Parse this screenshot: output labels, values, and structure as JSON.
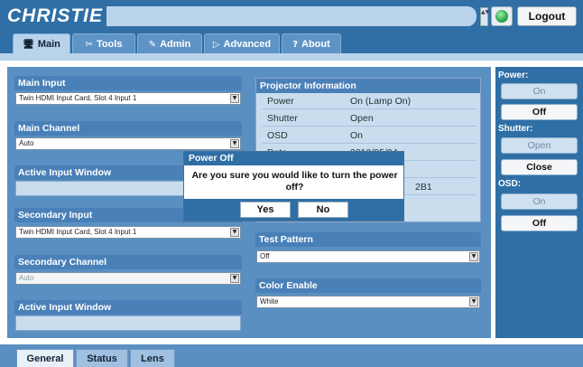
{
  "header": {
    "logo_text": "CHRISTIE",
    "logout_label": "Logout",
    "scroll_arrows": "▲▼"
  },
  "tabs": [
    {
      "label": "Main",
      "icon": "monitor-icon",
      "glyph": "🖥"
    },
    {
      "label": "Tools",
      "icon": "tools-icon",
      "glyph": "✂"
    },
    {
      "label": "Admin",
      "icon": "admin-icon",
      "glyph": "✎"
    },
    {
      "label": "Advanced",
      "icon": "advanced-icon",
      "glyph": "▷"
    },
    {
      "label": "About",
      "icon": "question-icon",
      "glyph": "?"
    }
  ],
  "left": {
    "main_input": {
      "title": "Main Input",
      "value": "Twin HDMI Input Card, Slot 4 Input 1"
    },
    "main_channel": {
      "title": "Main Channel",
      "value": "Auto"
    },
    "active_input_window": {
      "title": "Active Input Window"
    },
    "secondary_input": {
      "title": "Secondary Input",
      "value": "Twin HDMI Input Card, Slot 4 Input 1"
    },
    "secondary_channel": {
      "title": "Secondary Channel",
      "value": "Auto"
    },
    "active_input_window2": {
      "title": "Active Input Window"
    }
  },
  "projector_info": {
    "title": "Projector Information",
    "rows": [
      {
        "key": "Power",
        "value": "On (Lamp On)"
      },
      {
        "key": "Shutter",
        "value": "Open"
      },
      {
        "key": "OSD",
        "value": "On"
      },
      {
        "key": "Date",
        "value": "2010/05/04"
      },
      {
        "key": "",
        "value": ""
      },
      {
        "key": "",
        "value": "2B1"
      }
    ]
  },
  "test_pattern": {
    "title": "Test Pattern",
    "value": "Off"
  },
  "color_enable": {
    "title": "Color Enable",
    "value": "White"
  },
  "right_panel": {
    "power_label": "Power:",
    "power_on": "On",
    "power_off": "Off",
    "shutter_label": "Shutter:",
    "shutter_open": "Open",
    "shutter_close": "Close",
    "osd_label": "OSD:",
    "osd_on": "On",
    "osd_off": "Off"
  },
  "bottom_tabs": [
    "General",
    "Status",
    "Lens"
  ],
  "dialog": {
    "title": "Power Off",
    "message": "Are you sure you would like to turn the power off?",
    "yes": "Yes",
    "no": "No"
  },
  "colors": {
    "brand": "#2f6fa6",
    "panel": "#5a8fc2",
    "light": "#c9ddef",
    "status_ok": "#1f9a3b"
  }
}
